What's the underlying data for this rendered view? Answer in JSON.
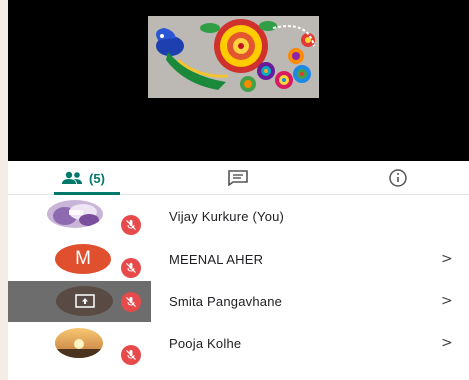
{
  "tabs": {
    "people_count": "(5)"
  },
  "participants": [
    {
      "name": "Vijay Kurkure (You)",
      "avatar": "photo-avatar",
      "muted": true,
      "has_chevron": false
    },
    {
      "name": "MEENAL AHER",
      "avatar_letter": "M",
      "muted": true,
      "has_chevron": true
    },
    {
      "name": "Smita Pangavhane",
      "avatar": "screen-present-icon",
      "muted": true,
      "has_chevron": true,
      "presenting": true
    },
    {
      "name": "Pooja Kolhe",
      "avatar": "sunset-photo-avatar",
      "muted": true,
      "has_chevron": true
    }
  ],
  "chevron": ">",
  "colors": {
    "accent": "#00796b",
    "mute_badge": "#e64a4a",
    "avatar_m": "#e0502f",
    "presenting_row": "#6d6d6d"
  }
}
